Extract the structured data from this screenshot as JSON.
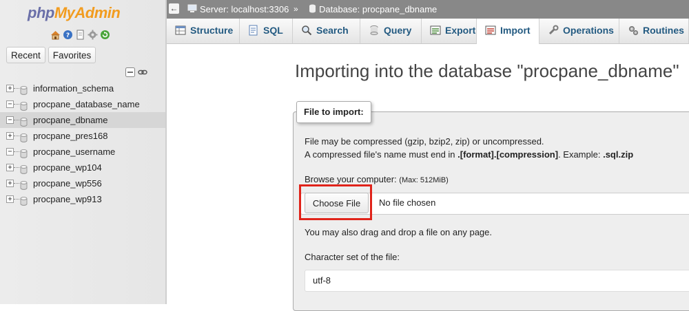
{
  "logo": {
    "php": "php",
    "myadmin": "MyAdmin"
  },
  "nav_icons": [
    "home-icon",
    "help-icon",
    "docs-icon",
    "settings-icon",
    "reload-icon"
  ],
  "nav_tabs": {
    "recent": "Recent",
    "favorites": "Favorites"
  },
  "databases": [
    {
      "name": "information_schema",
      "expander": "+"
    },
    {
      "name": "procpane_database_name",
      "expander": "−"
    },
    {
      "name": "procpane_dbname",
      "expander": "−",
      "selected": true
    },
    {
      "name": "procpane_pres168",
      "expander": "+"
    },
    {
      "name": "procpane_username",
      "expander": "−"
    },
    {
      "name": "procpane_wp104",
      "expander": "+"
    },
    {
      "name": "procpane_wp556",
      "expander": "+"
    },
    {
      "name": "procpane_wp913",
      "expander": "+"
    }
  ],
  "breadcrumb": {
    "server": "Server: localhost:3306",
    "separator": "»",
    "database": "Database: procpane_dbname"
  },
  "tabs": [
    {
      "label": "Structure",
      "icon": "structure-icon"
    },
    {
      "label": "SQL",
      "icon": "sql-icon"
    },
    {
      "label": "Search",
      "icon": "search-icon"
    },
    {
      "label": "Query",
      "icon": "query-icon"
    },
    {
      "label": "Export",
      "icon": "export-icon"
    },
    {
      "label": "Import",
      "icon": "import-icon",
      "active": true
    },
    {
      "label": "Operations",
      "icon": "operations-icon"
    },
    {
      "label": "Routines",
      "icon": "routines-icon"
    }
  ],
  "main": {
    "title": "Importing into the database \"procpane_dbname\"",
    "legend": "File to import:",
    "compress_line1": "File may be compressed (gzip, bzip2, zip) or uncompressed.",
    "compress_line2_pre": "A compressed file's name must end in ",
    "compress_line2_format": ".[format].[compression]",
    "compress_line2_mid": ". Example: ",
    "compress_line2_example": ".sql.zip",
    "browse_label": "Browse your computer:",
    "max_size": "(Max: 512MiB)",
    "choose_file": "Choose File",
    "no_file": "No file chosen",
    "drag_hint": "You may also drag and drop a file on any page.",
    "charset_label": "Character set of the file:",
    "charset_value": "utf-8"
  },
  "colors": {
    "tab_text": "#235a81",
    "highlight": "#e0231a",
    "logo_php": "#6a6fa8",
    "logo_myadmin": "#f29c1f"
  }
}
